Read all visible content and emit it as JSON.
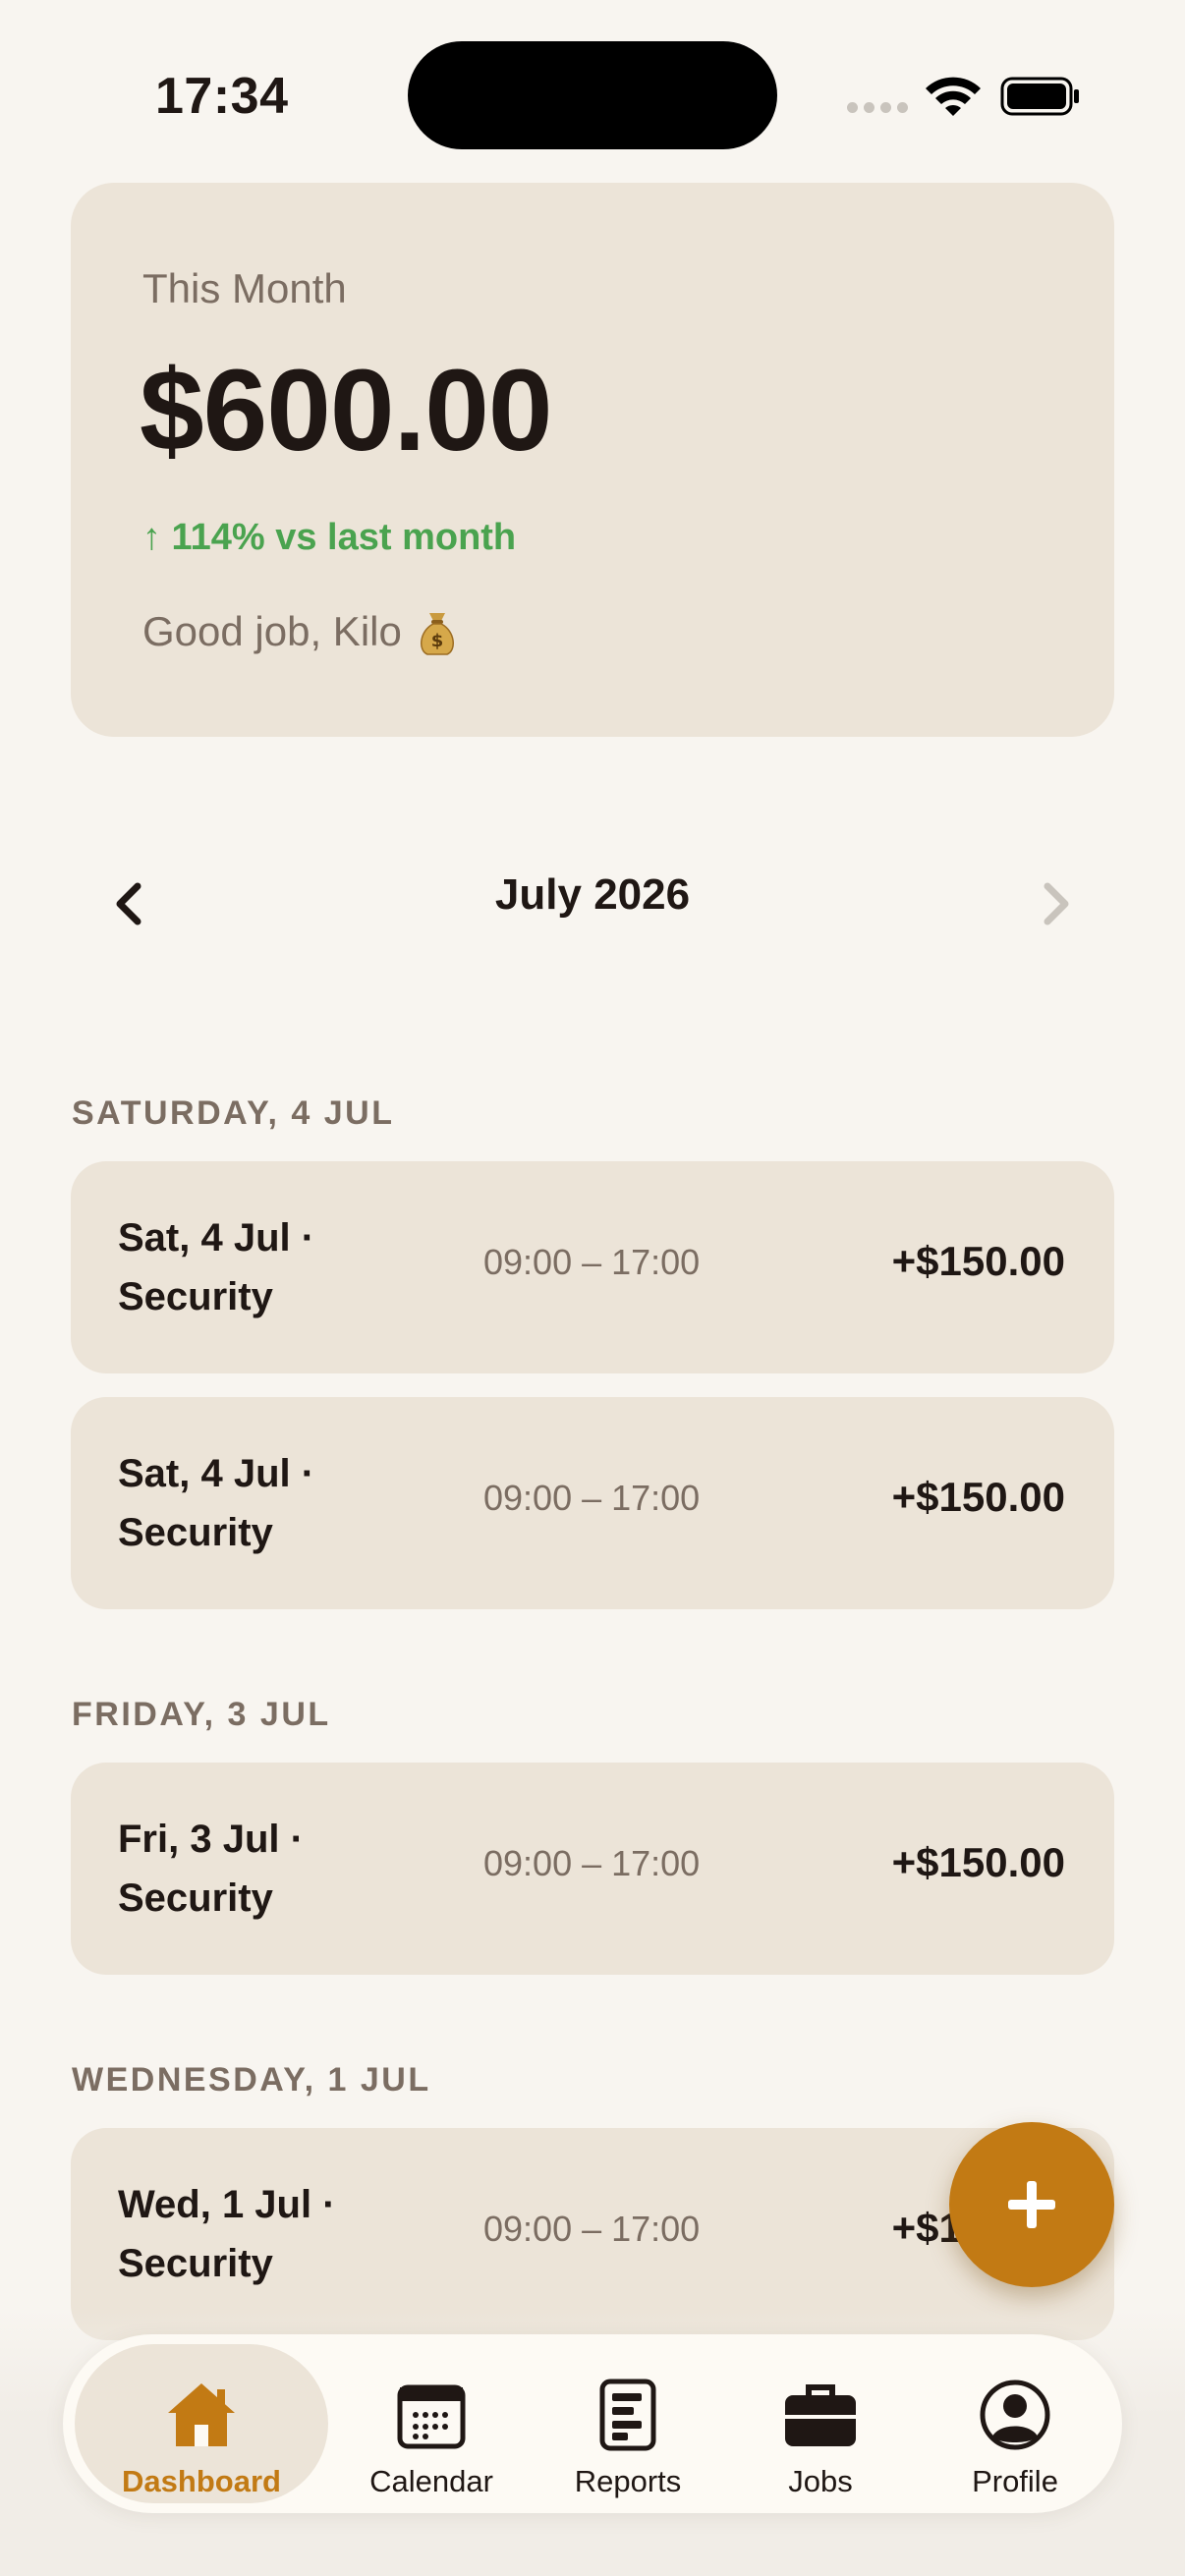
{
  "status_bar": {
    "time": "17:34"
  },
  "summary": {
    "label": "This Month",
    "amount": "$600.00",
    "change": "↑ 114% vs last month",
    "greeting": "Good job, Kilo",
    "greeting_icon": "money-bag-emoji",
    "change_color": "#4aa34f"
  },
  "month_nav": {
    "title": "July 2026",
    "prev_icon": "chevron-left-icon",
    "next_icon": "chevron-right-icon"
  },
  "days": [
    {
      "header": "SATURDAY, 4 JUL",
      "shifts": [
        {
          "title": "Sat, 4 Jul · Security",
          "time": "09:00 – 17:00",
          "amount": "+$150.00"
        },
        {
          "title": "Sat, 4 Jul · Security",
          "time": "09:00 – 17:00",
          "amount": "+$150.00"
        }
      ]
    },
    {
      "header": "FRIDAY, 3 JUL",
      "shifts": [
        {
          "title": "Fri, 3 Jul · Security",
          "time": "09:00 – 17:00",
          "amount": "+$150.00"
        }
      ]
    },
    {
      "header": "WEDNESDAY, 1 JUL",
      "shifts": [
        {
          "title": "Wed, 1 Jul · Security",
          "time": "09:00 – 17:00",
          "amount": "+$150.00"
        }
      ]
    }
  ],
  "fab": {
    "icon": "plus-icon",
    "accent": "#c27a14"
  },
  "bottom_nav": {
    "active": "Dashboard",
    "items": [
      {
        "label": "Dashboard",
        "icon": "home-icon"
      },
      {
        "label": "Calendar",
        "icon": "calendar-icon"
      },
      {
        "label": "Reports",
        "icon": "reports-icon"
      },
      {
        "label": "Jobs",
        "icon": "briefcase-icon"
      },
      {
        "label": "Profile",
        "icon": "profile-icon"
      }
    ]
  }
}
